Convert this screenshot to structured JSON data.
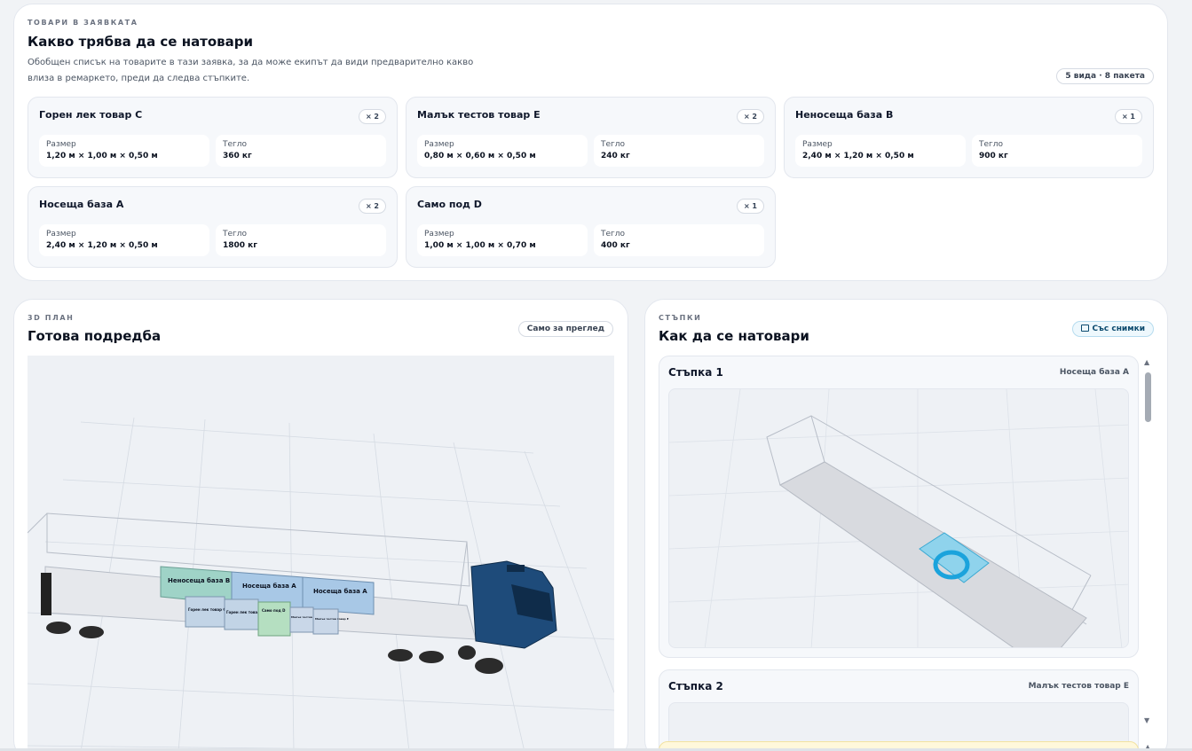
{
  "goods": {
    "eyebrow": "ТОВАРИ В ЗАЯВКАТА",
    "title": "Какво трябва да се натовари",
    "description_line1": "Обобщен списък на товарите в тази заявка, за да може екипът да види предварително какво",
    "description_line2": "влиза в ремаркето, преди да следва стъпките.",
    "summary_badge": "5 вида · 8 пакета",
    "size_label": "Размер",
    "weight_label": "Тегло",
    "items": [
      {
        "name": "Горен лек товар C",
        "qty": "× 2",
        "size": "1,20 м × 1,00 м × 0,50 м",
        "weight": "360 кг"
      },
      {
        "name": "Малък тестов товар E",
        "qty": "× 2",
        "size": "0,80 м × 0,60 м × 0,50 м",
        "weight": "240 кг"
      },
      {
        "name": "Неносеща база B",
        "qty": "× 1",
        "size": "2,40 м × 1,20 м × 0,50 м",
        "weight": "900 кг"
      },
      {
        "name": "Носеща база A",
        "qty": "× 2",
        "size": "2,40 м × 1,20 м × 0,50 м",
        "weight": "1800 кг"
      },
      {
        "name": "Само под D",
        "qty": "× 1",
        "size": "1,00 м × 1,00 м × 0,70 м",
        "weight": "400 кг"
      }
    ]
  },
  "plan": {
    "eyebrow": "3D ПЛАН",
    "title": "Готова подредба",
    "badge": "Само за преглед",
    "labels": {
      "base_b": "Неносеща база B",
      "base_a1": "Носеща база A",
      "base_a2": "Носеща база A",
      "upper_c1": "Горен лек товар C",
      "upper_c2": "Горен лек товар C",
      "floor_d": "Само под D",
      "small_e1": "Малък тестов товар E",
      "small_e2": "Малък тестов товар E"
    }
  },
  "steps": {
    "eyebrow": "СТЪПКИ",
    "title": "Как да се натовари",
    "badge": "Със снимки",
    "list": [
      {
        "title": "Стъпка 1",
        "target": "Носеща база A"
      },
      {
        "title": "Стъпка 2",
        "target": "Малък тестов товар E"
      }
    ]
  },
  "colors": {
    "accent": "#0ea5e9",
    "base_b": "#9fd3c7",
    "base_a": "#a8c8e6",
    "floor_d": "#b5dfc1",
    "truck_cab": "#1e4b7a"
  }
}
